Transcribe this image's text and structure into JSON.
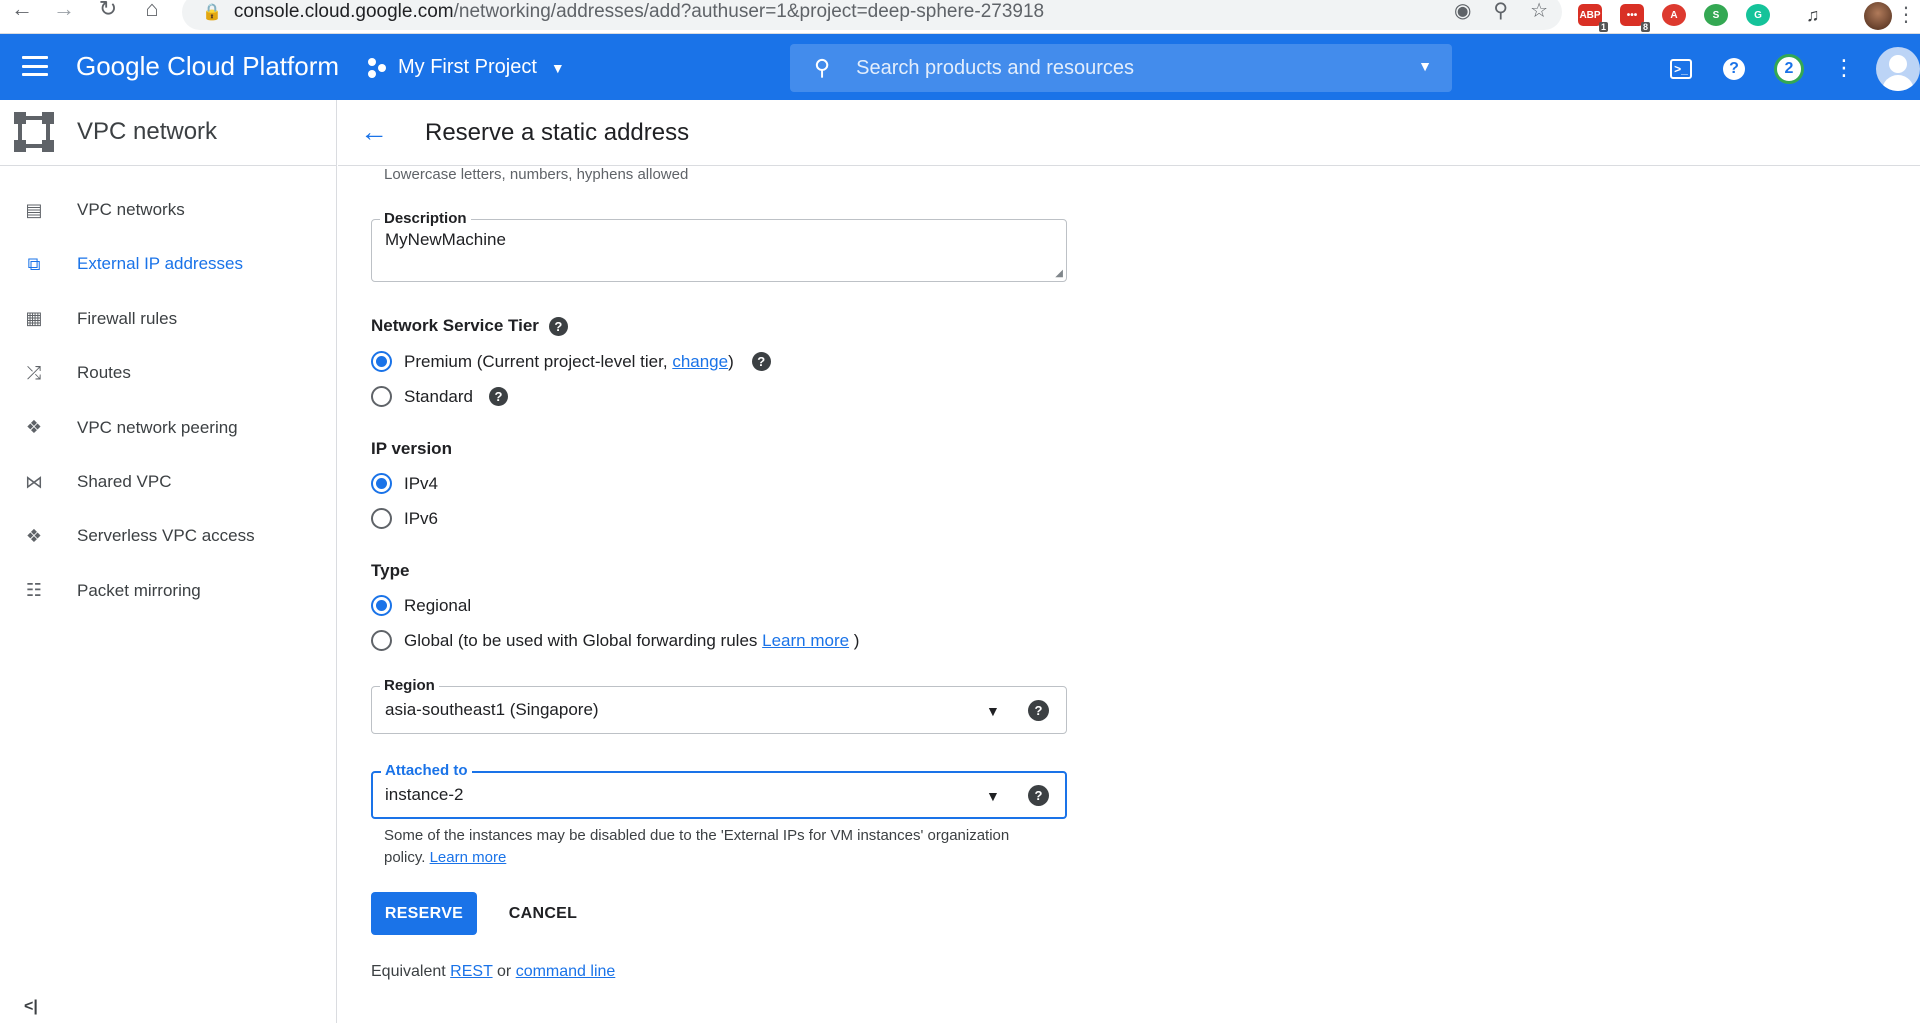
{
  "browser": {
    "url_host": "console.cloud.google.com",
    "url_path": "/networking/addresses/add?authuser=1&project=deep-sphere-273918",
    "extensions": [
      {
        "label": "ABP",
        "badge": "1",
        "color": "#d93025"
      },
      {
        "label": "•••",
        "badge": "8",
        "color": "#d93025"
      },
      {
        "label": "A",
        "badge": "",
        "color": "#dd3a2f"
      },
      {
        "label": "S",
        "badge": "",
        "color": "#34a853"
      },
      {
        "label": "G",
        "badge": "",
        "color": "#15c39a"
      }
    ]
  },
  "header": {
    "brand": "Google Cloud Platform",
    "project": "My First Project",
    "search_placeholder": "Search products and resources",
    "notification_count": "2",
    "accent_color": "#1a73e8"
  },
  "sidebar": {
    "title": "VPC network",
    "items": [
      {
        "label": "VPC networks",
        "icon": "network-icon"
      },
      {
        "label": "External IP addresses",
        "icon": "ip-address-icon",
        "active": true
      },
      {
        "label": "Firewall rules",
        "icon": "firewall-icon"
      },
      {
        "label": "Routes",
        "icon": "routes-icon"
      },
      {
        "label": "VPC network peering",
        "icon": "peering-icon"
      },
      {
        "label": "Shared VPC",
        "icon": "shared-vpc-icon"
      },
      {
        "label": "Serverless VPC access",
        "icon": "serverless-icon"
      },
      {
        "label": "Packet mirroring",
        "icon": "packet-mirroring-icon"
      }
    ]
  },
  "page": {
    "title": "Reserve a static address",
    "name_hint": "Lowercase letters, numbers, hyphens allowed",
    "description": {
      "label": "Description",
      "value": "MyNewMachine"
    },
    "network_tier": {
      "title": "Network Service Tier",
      "premium_prefix": "Premium (Current project-level tier, ",
      "premium_link": "change",
      "premium_suffix": ")",
      "standard": "Standard",
      "selected": "premium"
    },
    "ip_version": {
      "title": "IP version",
      "options": [
        "IPv4",
        "IPv6"
      ],
      "selected": "IPv4"
    },
    "type": {
      "title": "Type",
      "regional": "Regional",
      "global_prefix": "Global (to be used with Global forwarding rules ",
      "global_link": "Learn more",
      "global_suffix": " )",
      "selected": "regional"
    },
    "region": {
      "label": "Region",
      "value": "asia-southeast1 (Singapore)"
    },
    "attached_to": {
      "label": "Attached to",
      "value": "instance-2"
    },
    "helper_text": "Some of the instances may be disabled due to the 'External IPs for VM instances' organization policy. ",
    "helper_link": "Learn more",
    "reserve_label": "RESERVE",
    "cancel_label": "CANCEL",
    "equivalent_prefix": "Equivalent ",
    "rest_link": "REST",
    "or_text": " or ",
    "command_line_link": "command line"
  }
}
